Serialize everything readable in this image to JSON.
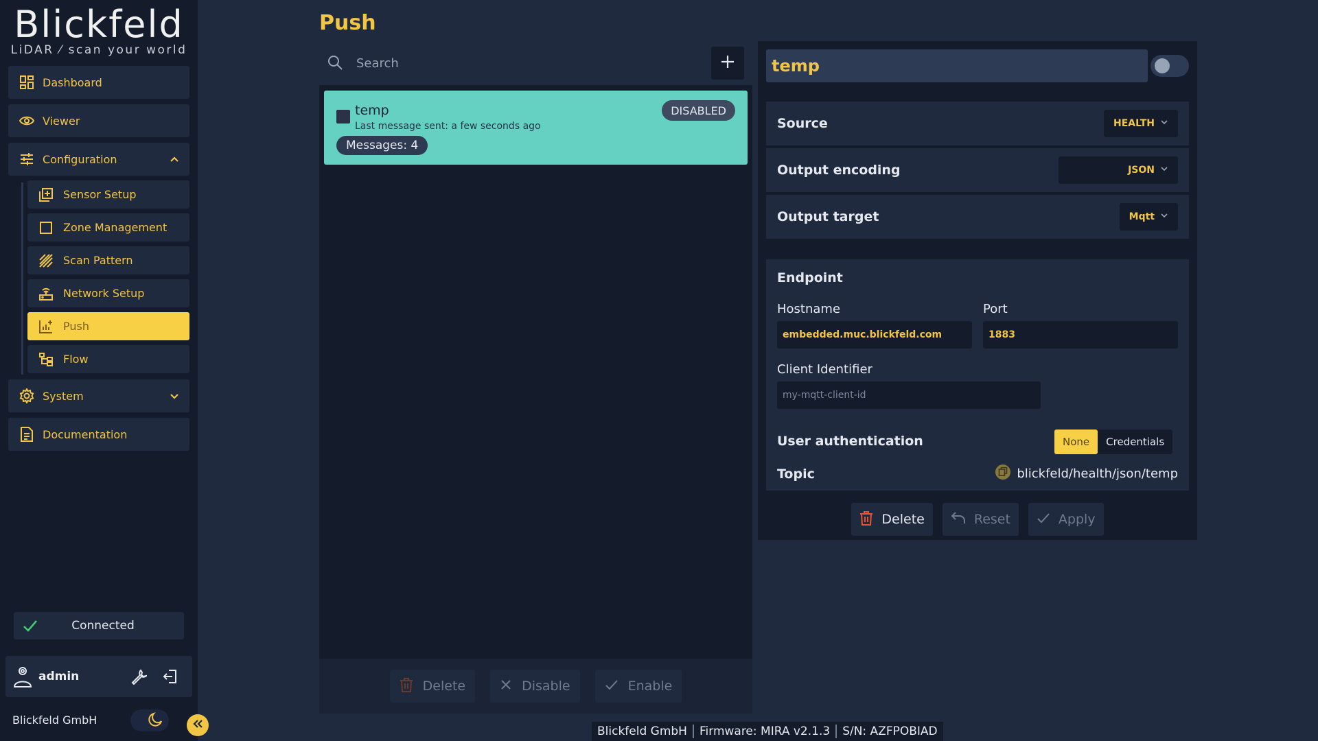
{
  "brand": {
    "name": "Blickfeld",
    "tagline": "LiDAR ⁄ scan your world"
  },
  "sidebar": {
    "items": [
      {
        "label": "Dashboard",
        "icon": "dashboard-icon"
      },
      {
        "label": "Viewer",
        "icon": "eye-icon"
      },
      {
        "label": "Configuration",
        "icon": "sliders-icon",
        "expanded": true
      },
      {
        "label": "System",
        "icon": "gear-icon",
        "expanded": false
      },
      {
        "label": "Documentation",
        "icon": "document-icon"
      }
    ],
    "sub_items": [
      {
        "label": "Sensor Setup",
        "icon": "sensor-add-icon"
      },
      {
        "label": "Zone Management",
        "icon": "square-icon"
      },
      {
        "label": "Scan Pattern",
        "icon": "hatch-icon"
      },
      {
        "label": "Network Setup",
        "icon": "router-icon"
      },
      {
        "label": "Push",
        "icon": "chart-push-icon",
        "active": true
      },
      {
        "label": "Flow",
        "icon": "flow-icon"
      }
    ],
    "connection_status": "Connected",
    "user": "admin",
    "company": "Blickfeld GmbH"
  },
  "page": {
    "title": "Push",
    "search_placeholder": "Search",
    "list": [
      {
        "name": "temp",
        "last_message": "Last message sent: a few seconds ago",
        "status": "DISABLED",
        "messages": "Messages: 4"
      }
    ],
    "list_actions": {
      "delete": "Delete",
      "disable": "Disable",
      "enable": "Enable"
    }
  },
  "detail": {
    "name": "temp",
    "enabled": false,
    "source_label": "Source",
    "source_value": "HEALTH",
    "encoding_label": "Output encoding",
    "encoding_value": "JSON",
    "target_label": "Output target",
    "target_value": "Mqtt",
    "endpoint": {
      "title": "Endpoint",
      "hostname_label": "Hostname",
      "hostname_value": "embedded.muc.blickfeld.com",
      "port_label": "Port",
      "port_value": "1883",
      "client_id_label": "Client Identifier",
      "client_id_placeholder": "my-mqtt-client-id",
      "auth_label": "User authentication",
      "auth_options": [
        "None",
        "Credentials"
      ],
      "auth_selected": "None",
      "topic_label": "Topic",
      "topic_value": "blickfeld/health/json/temp"
    },
    "actions": {
      "delete": "Delete",
      "reset": "Reset",
      "apply": "Apply"
    }
  },
  "statusbar": {
    "company": "Blickfeld GmbH",
    "firmware": "Firmware: MIRA v2.1.3",
    "serial": "S/N: AZFPOBIAD"
  },
  "colors": {
    "accent": "#f3c545",
    "card": "#65d1c3",
    "bg": "#1f2a3f",
    "panel": "#141c2c",
    "success": "#3ecf6a",
    "danger": "#e8542e"
  }
}
